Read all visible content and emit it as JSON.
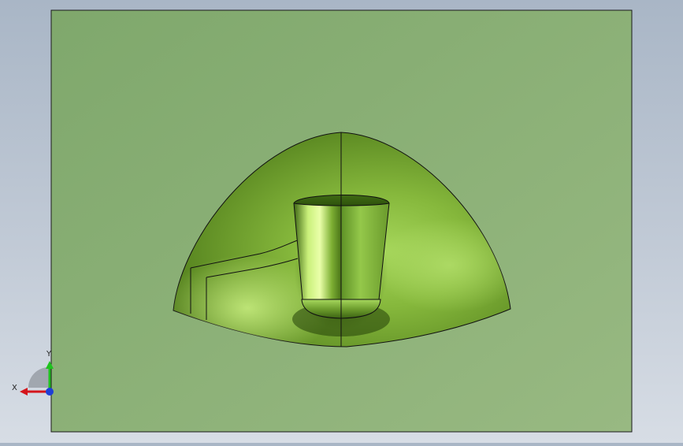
{
  "scene": {
    "background_top": "#a9b6c6",
    "background_bottom": "#d7dde5",
    "plate_color": "#8cb076",
    "part_color": "#7aa83a",
    "edge_color": "#111111"
  },
  "model": {
    "icon": "3d-part-model",
    "part_name": ""
  },
  "triad": {
    "icon": "view-orientation-triad",
    "x_label": "X",
    "y_label": "Y",
    "x_color": "#d4141b",
    "y_color": "#1ec21e",
    "z_color": "#1f3fd6"
  }
}
